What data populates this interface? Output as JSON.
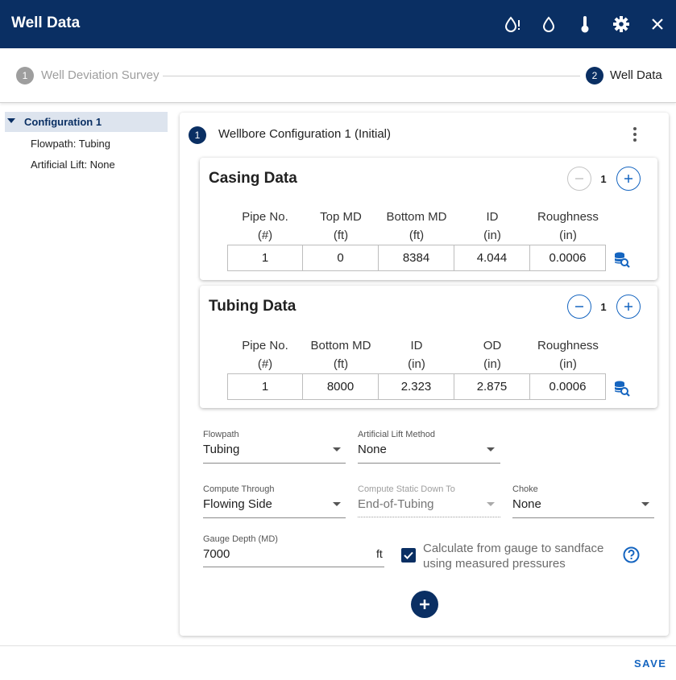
{
  "window": {
    "title": "Well Data",
    "icons": [
      "drop-alert-icon",
      "drop-icon",
      "thermometer-icon",
      "gear-icon",
      "close-icon"
    ]
  },
  "stepper": {
    "steps": [
      {
        "number": "1",
        "label": "Well Deviation Survey",
        "active": false
      },
      {
        "number": "2",
        "label": "Well Data",
        "active": true
      }
    ]
  },
  "sidebar": {
    "configuration": "Configuration 1",
    "items": [
      "Flowpath: Tubing",
      "Artificial Lift: None"
    ]
  },
  "config": {
    "number": "1",
    "title": "Wellbore Configuration 1 (Initial)"
  },
  "casing": {
    "title": "Casing Data",
    "count": "1",
    "headers": [
      {
        "name": "Pipe No.",
        "unit": "(#)"
      },
      {
        "name": "Top MD",
        "unit": "(ft)"
      },
      {
        "name": "Bottom MD",
        "unit": "(ft)"
      },
      {
        "name": "ID",
        "unit": "(in)"
      },
      {
        "name": "Roughness",
        "unit": "(in)"
      }
    ],
    "row": [
      "1",
      "0",
      "8384",
      "4.044",
      "0.0006"
    ]
  },
  "tubing": {
    "title": "Tubing Data",
    "count": "1",
    "headers": [
      {
        "name": "Pipe No.",
        "unit": "(#)"
      },
      {
        "name": "Bottom MD",
        "unit": "(ft)"
      },
      {
        "name": "ID",
        "unit": "(in)"
      },
      {
        "name": "OD",
        "unit": "(in)"
      },
      {
        "name": "Roughness",
        "unit": "(in)"
      }
    ],
    "row": [
      "1",
      "8000",
      "2.323",
      "2.875",
      "0.0006"
    ]
  },
  "fields": {
    "flowpath": {
      "label": "Flowpath",
      "value": "Tubing"
    },
    "artificial_lift": {
      "label": "Artificial Lift Method",
      "value": "None"
    },
    "compute_through": {
      "label": "Compute Through",
      "value": "Flowing Side"
    },
    "compute_static": {
      "label": "Compute Static Down To",
      "value": "End-of-Tubing"
    },
    "choke": {
      "label": "Choke",
      "value": "None"
    },
    "gauge_depth": {
      "label": "Gauge Depth (MD)",
      "value": "7000",
      "unit": "ft"
    }
  },
  "checkbox": {
    "checked": true,
    "label": "Calculate from gauge to sandface using measured pressures"
  },
  "footer": {
    "save_label": "SAVE"
  },
  "colors": {
    "primary": "#0a2f63",
    "accent": "#1565c0"
  }
}
